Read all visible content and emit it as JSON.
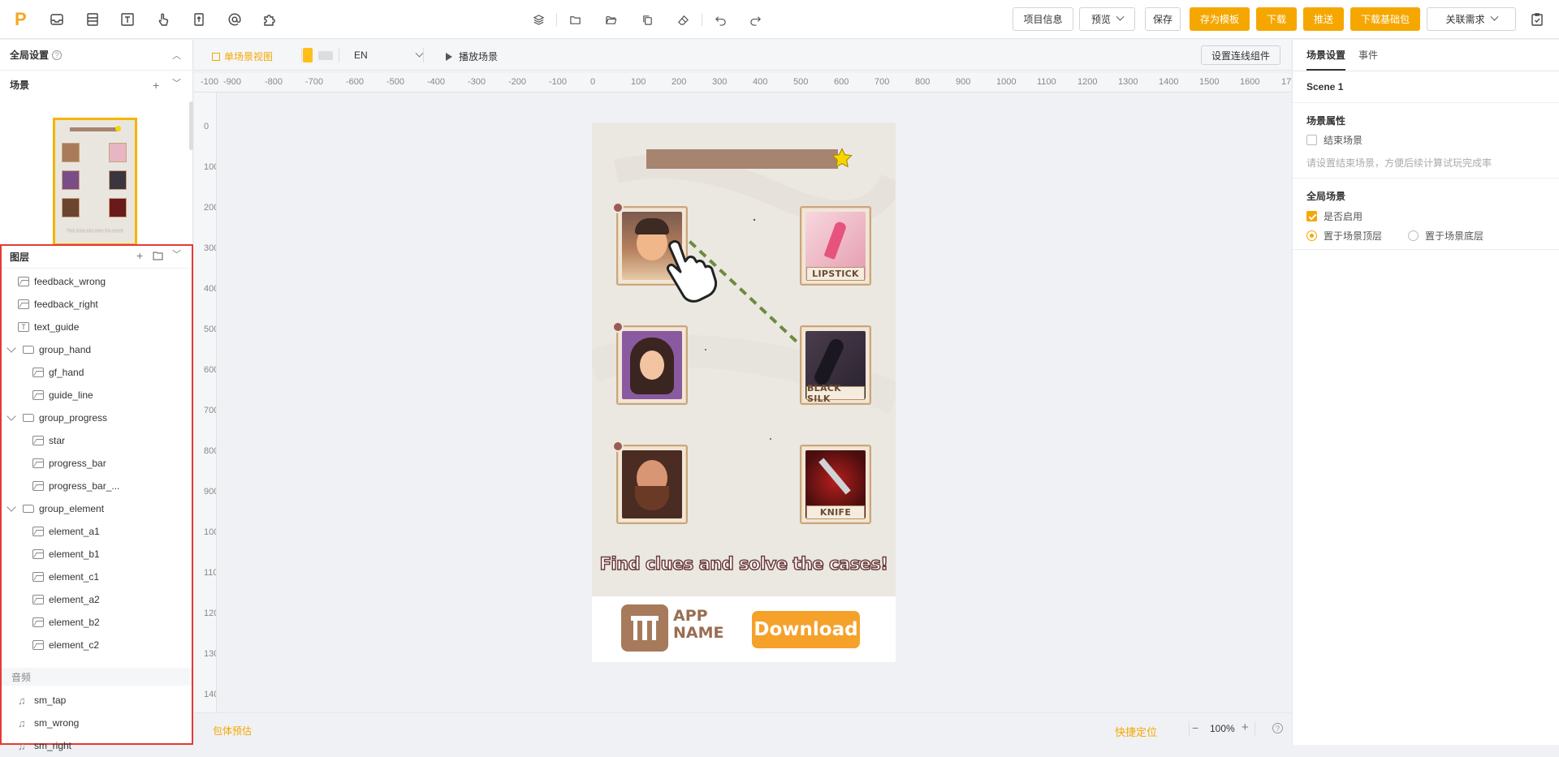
{
  "topbar": {
    "logo": "P",
    "buttons": {
      "project_info": "项目信息",
      "preview": "预览",
      "save": "保存",
      "save_template": "存为模板",
      "download": "下载",
      "push": "推送",
      "download_base": "下载基础包",
      "linked_requirements": "关联需求"
    }
  },
  "left": {
    "global_settings": "全局设置",
    "scenes_title": "场景",
    "thumb_caption": "Find clues and solve the cases!",
    "layers_title": "图层",
    "layers": [
      {
        "name": "feedback_wrong",
        "type": "image",
        "indent": 0
      },
      {
        "name": "feedback_right",
        "type": "image",
        "indent": 0
      },
      {
        "name": "text_guide",
        "type": "text",
        "indent": 0
      },
      {
        "name": "group_hand",
        "type": "group",
        "indent": 0
      },
      {
        "name": "gf_hand",
        "type": "image",
        "indent": 1
      },
      {
        "name": "guide_line",
        "type": "image",
        "indent": 1
      },
      {
        "name": "group_progress",
        "type": "group",
        "indent": 0
      },
      {
        "name": "star",
        "type": "image",
        "indent": 1
      },
      {
        "name": "progress_bar",
        "type": "image",
        "indent": 1
      },
      {
        "name": "progress_bar_...",
        "type": "image",
        "indent": 1
      },
      {
        "name": "group_element",
        "type": "group",
        "indent": 0
      },
      {
        "name": "element_a1",
        "type": "image",
        "indent": 1
      },
      {
        "name": "element_b1",
        "type": "image",
        "indent": 1
      },
      {
        "name": "element_c1",
        "type": "image",
        "indent": 1
      },
      {
        "name": "element_a2",
        "type": "image",
        "indent": 1
      },
      {
        "name": "element_b2",
        "type": "image",
        "indent": 1
      },
      {
        "name": "element_c2",
        "type": "image",
        "indent": 1
      }
    ],
    "audio_title": "音频",
    "audio": [
      "sm_tap",
      "sm_wrong",
      "sm_right"
    ]
  },
  "toolbar2": {
    "single_scene_view": "单场景视图",
    "language": "EN",
    "play_scene": "播放场景",
    "set_connection": "设置连线组件"
  },
  "ruler": {
    "top": [
      "-100",
      "-900",
      "-800",
      "-700",
      "-600",
      "-500",
      "-400",
      "-300",
      "-200",
      "-100",
      "0",
      "100",
      "200",
      "300",
      "400",
      "500",
      "600",
      "700",
      "800",
      "900",
      "1000",
      "1100",
      "1200",
      "1300",
      "1400",
      "1500",
      "1600",
      "17"
    ],
    "left": [
      "0",
      "100",
      "200",
      "300",
      "400",
      "500",
      "600",
      "700",
      "800",
      "900",
      "1000",
      "1100",
      "1200",
      "1300",
      "1400"
    ]
  },
  "stage": {
    "cards_right": [
      "LIPSTICK",
      "BLACK SILK",
      "KNIFE"
    ],
    "headline": "Find clues and solve the cases!",
    "app_name_line1": "APP",
    "app_name_line2": "NAME",
    "download": "Download",
    "progress": 0
  },
  "bottombar": {
    "package_estimate": "包体预估",
    "quick_locate": "快捷定位",
    "zoom": "100%"
  },
  "right": {
    "tab_scene_settings": "场景设置",
    "tab_events": "事件",
    "scene_name": "Scene 1",
    "scene_props_title": "场景属性",
    "end_scene_label": "结束场景",
    "end_scene_checked": false,
    "end_scene_hint": "请设置结束场景，方便后续计算试玩完成率",
    "global_scene_title": "全局场景",
    "enable_label": "是否启用",
    "enable_checked": true,
    "layer_top_label": "置于场景顶层",
    "layer_bottom_label": "置于场景底层",
    "layer_choice": "top"
  },
  "colors": {
    "accent": "#f5a700",
    "highlight_border": "#e53935",
    "stage_bg": "#ebe8e2",
    "progress_bar": "#a68470",
    "download_btn": "#f5a12a"
  }
}
